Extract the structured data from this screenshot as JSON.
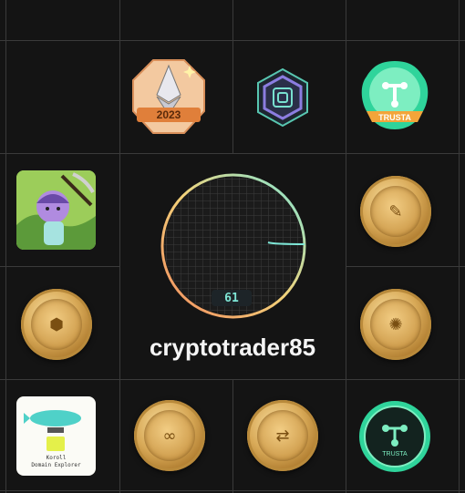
{
  "profile": {
    "username": "cryptotrader85",
    "score": "61"
  },
  "badges": {
    "year_badge": {
      "label": "2023",
      "icon": "ethereum-year-badge"
    },
    "hex_badge": {
      "icon": "hexagon-spiral-badge"
    },
    "trusta_top": {
      "label": "TRUSTA",
      "icon": "trusta-badge"
    },
    "miner_nft": {
      "icon": "miner-character-nft"
    },
    "explorer_nft": {
      "label": "Koroll\nDomain Explorer",
      "icon": "airship-explorer-nft"
    },
    "trusta_bottom": {
      "label": "TRUSTA",
      "icon": "trusta-coin"
    }
  },
  "colors": {
    "background": "#141414",
    "grid": "#3a3a3a",
    "ring_start": "#f08a5d",
    "ring_end": "#7ee6d6",
    "trusta_green": "#2fd49b",
    "gold": "#d8a957"
  }
}
